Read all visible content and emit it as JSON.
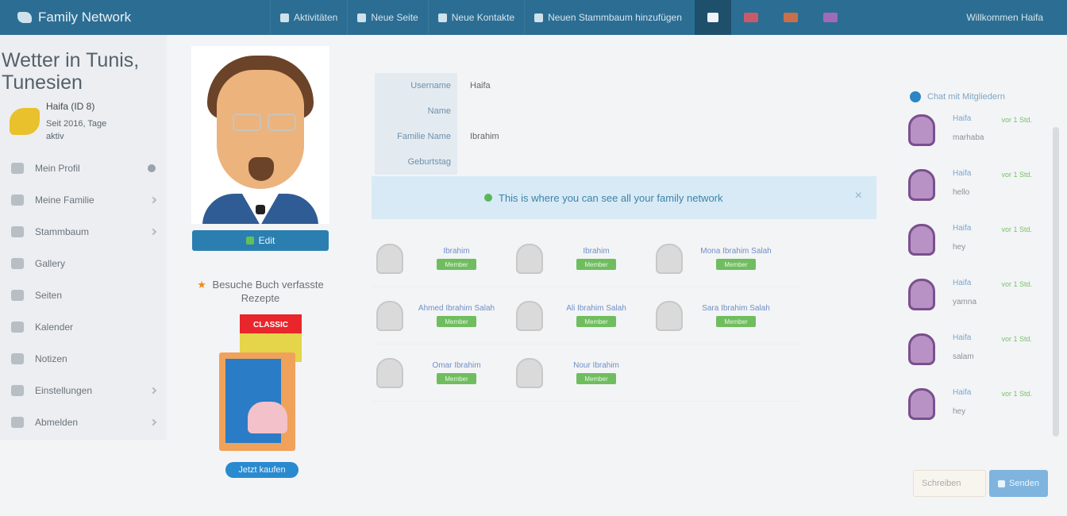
{
  "nav": {
    "brand": "Family Network",
    "links": [
      {
        "label": "Aktivitäten",
        "icon": "activity-icon"
      },
      {
        "label": "Neue Seite",
        "icon": "page-icon"
      },
      {
        "label": "Neue Kontakte",
        "icon": "contacts-icon"
      },
      {
        "label": "Neuen Stammbaum hinzufügen",
        "icon": "tree-icon"
      }
    ],
    "active_icon": "chat-icon",
    "flags": [
      {
        "name": "english-flag",
        "color": "#c95a6a"
      },
      {
        "name": "german-flag",
        "color": "#c9704a"
      },
      {
        "name": "french-flag",
        "color": "#9f6bb8"
      }
    ],
    "right_label": "Willkommen Haifa"
  },
  "sidebar": {
    "title": "Wetter in Tunis, Tunesien",
    "username": "Haifa (ID 8)",
    "member_since": "Seit 2016, Tage",
    "member_extra": "aktiv",
    "items": [
      {
        "label": "Mein Profil",
        "end": "dot",
        "icon": "user-icon"
      },
      {
        "label": "Meine Familie",
        "end": "chev",
        "icon": "family-icon"
      },
      {
        "label": "Stammbaum",
        "end": "chev",
        "icon": "tree-icon"
      },
      {
        "label": "Gallery",
        "end": "none",
        "icon": "gallery-icon"
      },
      {
        "label": "Seiten",
        "end": "none",
        "icon": "pages-icon"
      },
      {
        "label": "Kalender",
        "end": "none",
        "icon": "calendar-icon"
      },
      {
        "label": "Notizen",
        "end": "none",
        "icon": "notes-icon"
      },
      {
        "label": "Einstellungen",
        "end": "chev",
        "icon": "settings-icon"
      },
      {
        "label": "Abmelden",
        "end": "chev",
        "icon": "logout-icon"
      }
    ]
  },
  "profile": {
    "edit_label": "Edit",
    "promo_text": "Besuche Buch verfasste Rezepte",
    "book_banner": "CLASSIC",
    "order_label": "Jetzt kaufen"
  },
  "info": {
    "rows": [
      {
        "key": "Username",
        "value": "Haifa"
      },
      {
        "key": "Name",
        "value": ""
      },
      {
        "key": "Familie Name",
        "value": "Ibrahim"
      },
      {
        "key": "Geburtstag",
        "value": ""
      }
    ]
  },
  "alert": {
    "text": "This is where you can see all your family network",
    "close": "×"
  },
  "members": [
    [
      {
        "name": "Ibrahim",
        "badge": "Member"
      },
      {
        "name": "Ibrahim",
        "badge": "Member"
      },
      {
        "name": "Mona Ibrahim Salah",
        "badge": "Member"
      }
    ],
    [
      {
        "name": "Ahmed Ibrahim Salah",
        "badge": "Member"
      },
      {
        "name": "Ali Ibrahim Salah",
        "badge": "Member"
      },
      {
        "name": "Sara Ibrahim Salah",
        "badge": "Member"
      }
    ],
    [
      {
        "name": "Omar Ibrahim",
        "badge": "Member"
      },
      {
        "name": "Nour Ibrahim",
        "badge": "Member"
      }
    ]
  ],
  "chat": {
    "header": "Chat mit Mitgliedern",
    "messages": [
      {
        "who": "Haifa",
        "msg": "marhaba",
        "time": "vor 1 Std."
      },
      {
        "who": "Haifa",
        "msg": "hello",
        "time": "vor 1 Std."
      },
      {
        "who": "Haifa",
        "msg": "hey",
        "time": "vor 1 Std."
      },
      {
        "who": "Haifa",
        "msg": "yamna",
        "time": "vor 1 Std."
      },
      {
        "who": "Haifa",
        "msg": "salam",
        "time": "vor 1 Std."
      },
      {
        "who": "Haifa",
        "msg": "hey",
        "time": "vor 1 Std."
      }
    ],
    "input_placeholder": "Schreiben",
    "send_label": "Senden"
  }
}
